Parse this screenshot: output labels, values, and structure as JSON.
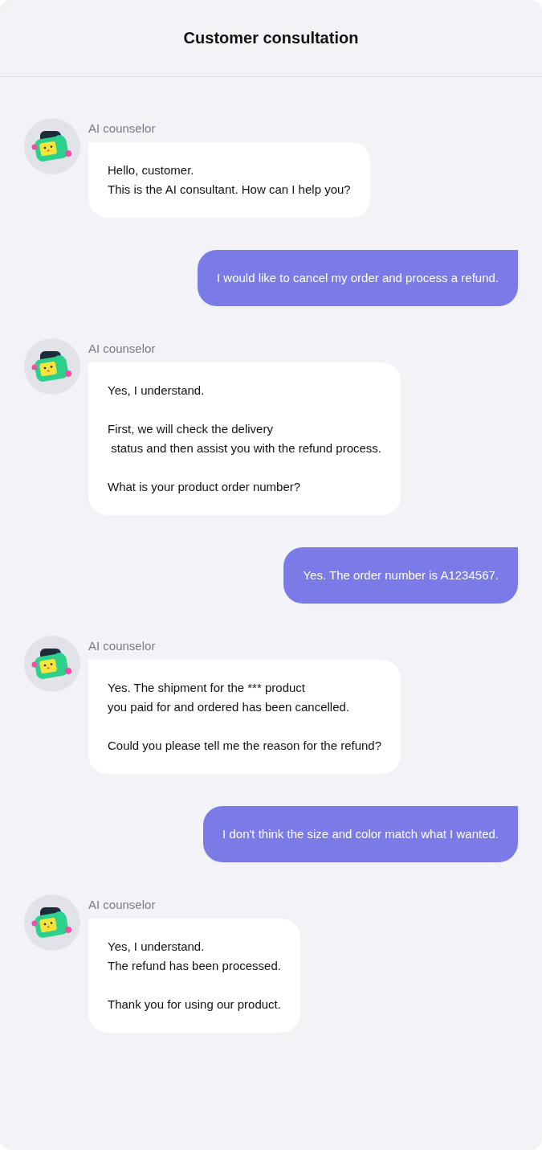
{
  "header": {
    "title": "Customer consultation"
  },
  "messages": [
    {
      "kind": "bot",
      "sender": "AI counselor",
      "paragraphs": [
        "Hello, customer.\nThis is the AI consultant. How can I help you?"
      ]
    },
    {
      "kind": "user",
      "paragraphs": [
        "I would like to cancel my order and process a refund."
      ]
    },
    {
      "kind": "bot",
      "sender": "AI counselor",
      "paragraphs": [
        "Yes, I understand.",
        "First, we will check the delivery\n status and then assist you with the refund process.",
        "What is your product order number?"
      ]
    },
    {
      "kind": "user",
      "paragraphs": [
        "Yes. The order number is A1234567."
      ]
    },
    {
      "kind": "bot",
      "sender": "AI counselor",
      "paragraphs": [
        "Yes. The shipment for the *** product\nyou paid for and ordered has been cancelled.",
        "Could you please tell me the reason for the refund?"
      ]
    },
    {
      "kind": "user",
      "paragraphs": [
        "I don't think the size and color match what I wanted."
      ]
    },
    {
      "kind": "bot",
      "sender": "AI counselor",
      "paragraphs": [
        "Yes, I understand.\nThe refund has been processed.",
        "Thank you for using our product."
      ]
    }
  ]
}
